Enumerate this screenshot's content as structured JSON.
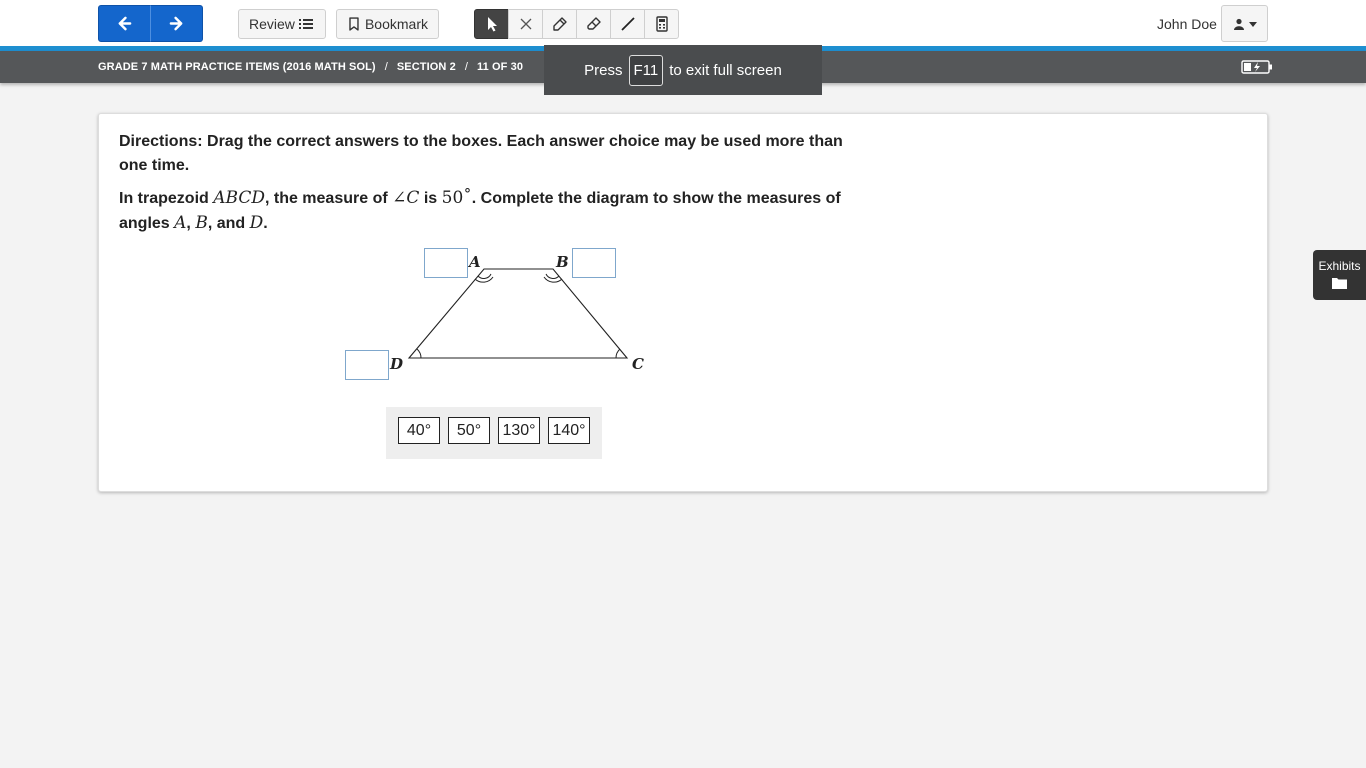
{
  "toolbar": {
    "review_label": "Review",
    "bookmark_label": "Bookmark",
    "username": "John Doe"
  },
  "breadcrumb": {
    "test": "GRADE 7 MATH PRACTICE ITEMS (2016 MATH SOL)",
    "separator": "/",
    "section": "SECTION 2",
    "position": "11 OF 30"
  },
  "fullscreen_notice": {
    "before": "Press",
    "key": "F11",
    "after": "to exit full screen"
  },
  "item": {
    "directions": "Directions: Drag the correct answers to the boxes. Each answer choice may be used more than one time.",
    "question": {
      "p1": "In trapezoid ",
      "shape": "ABCD",
      "p2": ", the measure of ",
      "angle": "∠C",
      "p3": " is ",
      "value": "50˚",
      "p4": ". Complete the diagram to show the measures of angles ",
      "a": "A",
      "c1": ", ",
      "b": "B",
      "c2": ", and ",
      "d": "D",
      "p5": "."
    },
    "vertices": {
      "A": "A",
      "B": "B",
      "C": "C",
      "D": "D"
    },
    "choices": [
      "40°",
      "50°",
      "130°",
      "140°"
    ]
  },
  "exhibits_label": "Exhibits",
  "colors": {
    "nav_blue": "#1466cc",
    "accent_rule": "#1e8fd0",
    "crumb_bar": "#555759",
    "active_tool": "#444444"
  },
  "icons": {
    "prev": "arrow-left-icon",
    "next": "arrow-right-icon",
    "review": "list-icon",
    "bookmark": "bookmark-icon",
    "tools": [
      "pointer-icon",
      "strikethrough-icon",
      "highlighter-icon",
      "eraser-icon",
      "line-icon",
      "calculator-icon"
    ],
    "user": "user-icon",
    "battery": "battery-charging-icon",
    "exhibits": "folder-icon"
  }
}
